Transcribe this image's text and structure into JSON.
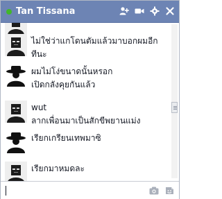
{
  "header": {
    "title": "Tan Tissana",
    "status": "online",
    "icons": [
      "add-friend-icon",
      "video-call-icon",
      "settings-icon",
      "close-icon"
    ]
  },
  "messages": [
    {
      "lines": [
        "ไม่ใช่ว่าแกโดนตัมแล้วมาบอกผมอีก",
        "ทีนะ"
      ],
      "avatar": "dark-avatar"
    },
    {
      "lines": [
        "ผมไม่โง่ขนาดนั้นหรอก",
        "เปิดกลังคุยกันแล้ว"
      ],
      "avatar": "hat-avatar"
    },
    {
      "lines": [
        "wut",
        "ลากเพื่อนมาเป็นสักขีพยานแม่ง"
      ],
      "avatar": "dark-avatar"
    },
    {
      "lines": [
        "เรียกเกรียนเทพมาซิ"
      ],
      "avatar": "hat-avatar"
    },
    {
      "lines": [
        "เรียกมาหมดละ"
      ],
      "avatar": "dark-avatar"
    }
  ],
  "composer": {
    "value": "",
    "icons": [
      "camera-icon",
      "sticker-icon"
    ]
  }
}
